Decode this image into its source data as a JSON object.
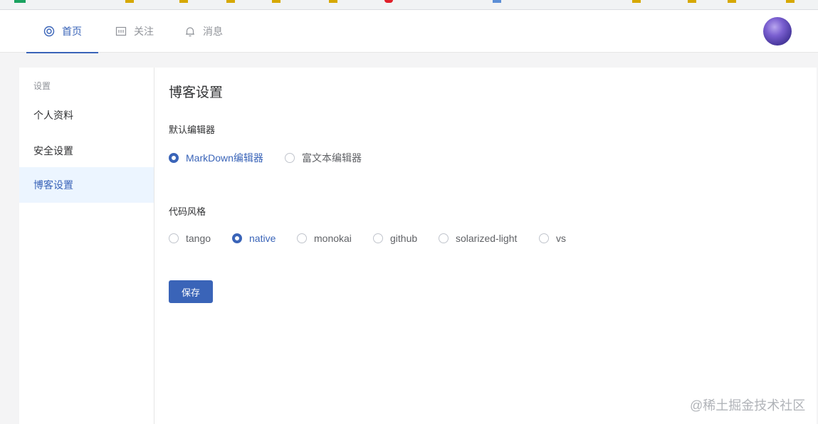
{
  "nav": {
    "items": [
      {
        "label": "首页",
        "icon": "home-icon",
        "active": true
      },
      {
        "label": "关注",
        "icon": "follow-icon",
        "active": false
      },
      {
        "label": "消息",
        "icon": "bell-icon",
        "active": false
      }
    ]
  },
  "sidebar": {
    "group_label": "设置",
    "items": [
      {
        "label": "个人资料",
        "active": false
      },
      {
        "label": "安全设置",
        "active": false
      },
      {
        "label": "博客设置",
        "active": true
      }
    ]
  },
  "main": {
    "title": "博客设置",
    "editor": {
      "label": "默认编辑器",
      "options": [
        "MarkDown编辑器",
        "富文本编辑器"
      ],
      "selected": "MarkDown编辑器"
    },
    "code_style": {
      "label": "代码风格",
      "options": [
        "tango",
        "native",
        "monokai",
        "github",
        "solarized-light",
        "vs"
      ],
      "selected": "native"
    },
    "save_label": "保存"
  },
  "watermark": "@稀土掘金技术社区",
  "colors": {
    "accent": "#3a64b8",
    "active_bg": "#ecf5ff",
    "page_bg": "#f4f4f5"
  }
}
